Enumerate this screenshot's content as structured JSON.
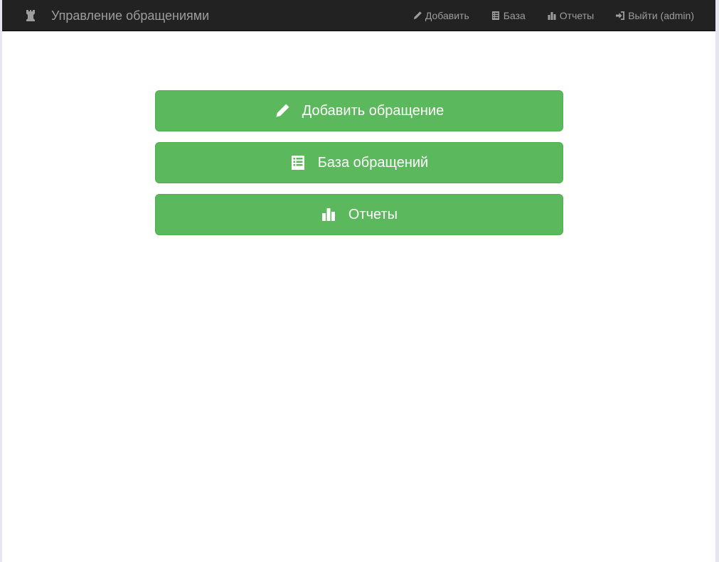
{
  "navbar": {
    "brand": {
      "label": "Управление обращениями",
      "icon": "tower-icon"
    },
    "items": [
      {
        "label": "Добавить",
        "icon": "pencil-icon"
      },
      {
        "label": "База",
        "icon": "list-icon"
      },
      {
        "label": "Отчеты",
        "icon": "stats-icon"
      },
      {
        "label": "Выйти (admin)",
        "icon": "log-in-icon"
      }
    ]
  },
  "main": {
    "buttons": [
      {
        "label": "Добавить обращение",
        "icon": "pencil-icon"
      },
      {
        "label": "База обращений",
        "icon": "list-icon"
      },
      {
        "label": "Отчеты",
        "icon": "stats-icon"
      }
    ]
  },
  "colors": {
    "navbar_bg": "#222222",
    "navbar_text": "#9d9d9d",
    "button_success": "#5cb85c"
  }
}
